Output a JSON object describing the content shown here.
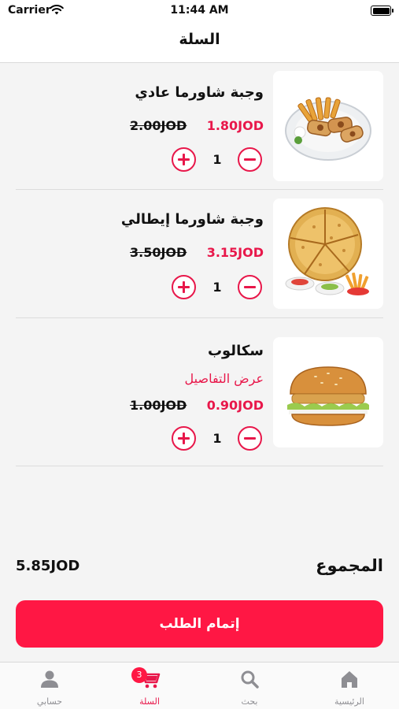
{
  "status_bar": {
    "carrier": "Carrier",
    "time": "11:44 AM"
  },
  "header": {
    "title": "السلة"
  },
  "cart": {
    "items": [
      {
        "name": "وجبة شاورما عادي",
        "price": "1.80JOD",
        "old_price": "2.00JOD",
        "quantity": "1",
        "image_icon": "shawarma-platter-image"
      },
      {
        "name": "وجبة شاورما إيطالي",
        "price": "3.15JOD",
        "old_price": "3.50JOD",
        "quantity": "1",
        "image_icon": "italian-shawarma-image"
      },
      {
        "name": "سكالوب",
        "details_link": "عرض التفاصيل",
        "price": "0.90JOD",
        "old_price": "1.00JOD",
        "quantity": "1",
        "image_icon": "burger-image"
      }
    ]
  },
  "summary": {
    "total_label": "المجموع",
    "total_value": "5.85JOD"
  },
  "checkout": {
    "label": "إتمام الطلب"
  },
  "tab_bar": {
    "tabs": [
      {
        "label": "حسابي",
        "icon": "person-icon"
      },
      {
        "label": "السلة",
        "icon": "cart-icon",
        "badge": "3",
        "active": true
      },
      {
        "label": "بحث",
        "icon": "search-icon"
      },
      {
        "label": "الرئيسية",
        "icon": "home-icon"
      }
    ]
  },
  "colors": {
    "accent": "#e8174a",
    "button": "#ff1744",
    "background": "#f4f4f4"
  }
}
